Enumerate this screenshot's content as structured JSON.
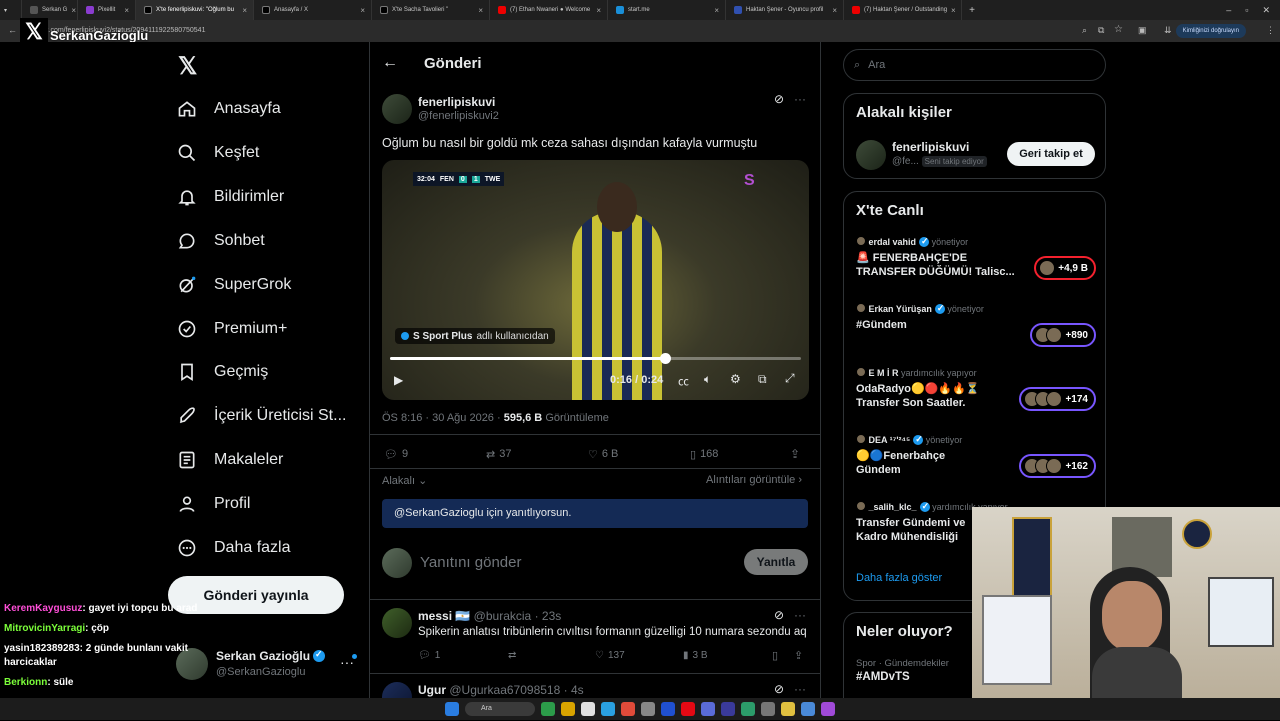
{
  "browser": {
    "tabs": [
      {
        "label": "Serkan G"
      },
      {
        "label": "Pixellit"
      },
      {
        "label": "X'te fenerlipiskuvi: \"Oğlum bu"
      },
      {
        "label": "Anasayfa / X"
      },
      {
        "label": "X'te Sacha Tavolieri \""
      },
      {
        "label": "(7) Ethan Nwaneri ● Welcome"
      },
      {
        "label": "start.me"
      },
      {
        "label": "Haktan Şener - Oyuncu profil"
      },
      {
        "label": "(7) Haktan Şener / Outstanding"
      }
    ],
    "url": "x.com/fenerlipiskuvi2/status/2094111922580750541",
    "verify_label": "Kimliğinizi doğrulayın",
    "stream_overlay_name": "SerkanGazioglu"
  },
  "nav": {
    "items": [
      {
        "label": "Anasayfa",
        "icon": "home-icon"
      },
      {
        "label": "Keşfet",
        "icon": "search-icon"
      },
      {
        "label": "Bildirimler",
        "icon": "bell-icon"
      },
      {
        "label": "Sohbet",
        "icon": "chat-icon"
      },
      {
        "label": "SuperGrok",
        "icon": "grok-icon"
      },
      {
        "label": "Premium+",
        "icon": "verified-icon"
      },
      {
        "label": "Geçmiş",
        "icon": "bookmark-icon"
      },
      {
        "label": "İçerik Üreticisi St...",
        "icon": "rocket-icon"
      },
      {
        "label": "Makaleler",
        "icon": "article-icon"
      },
      {
        "label": "Profil",
        "icon": "person-icon"
      },
      {
        "label": "Daha fazla",
        "icon": "more-circle-icon"
      }
    ],
    "post_button": "Gönderi yayınla",
    "account": {
      "name": "Serkan Gazioğlu",
      "handle": "@SerkanGazioglu"
    }
  },
  "chat_overlay": [
    {
      "user": "KeremKaygusuz",
      "color": "#ff4fd8",
      "text": ": gayet iyi topçu bu arad"
    },
    {
      "user": "MitrovicinYarragi",
      "color": "#7cff3a",
      "text": ": çöp"
    },
    {
      "user": "yasin182389283",
      "color": "#ffffff",
      "text": ": 2 günde bunlanı vakit harcicaklar"
    },
    {
      "user": "Berkionn",
      "color": "#7cff3a",
      "text": ": süle"
    }
  ],
  "main": {
    "header_title": "Gönderi",
    "post": {
      "name": "fenerlipiskuvi",
      "handle": "@fenerlipiskuvi2",
      "text": "Oğlum bu nasıl bir goldü mk ceza sahası dışından kafayla vurmuştu",
      "video": {
        "scoreboard_time": "32:04",
        "home": "FEN",
        "score_home": "0",
        "score_away": "1",
        "away": "TWE",
        "source_channel": "S Sport Plus",
        "source_suffix": "adlı kullanıcıdan",
        "time_current": "0:16",
        "time_total": "0:24",
        "played_fraction": 0.67
      },
      "time": "ÖS 8:16",
      "date": "30 Ağu 2026",
      "views_value": "595,6 B",
      "views_label": "Görüntüleme",
      "replies": "9",
      "reposts": "37",
      "likes": "6 B",
      "bookmarks": "168"
    },
    "sort_label": "Alakalı",
    "quotes_label": "Alıntıları görüntüle",
    "reply_banner": "@SerkanGazioglu için yanıtlıyorsun.",
    "reply_placeholder": "Yanıtını gönder",
    "reply_button": "Yanıtla",
    "replies": [
      {
        "name": "messi",
        "flag": "🇦🇷",
        "handle": "@burakcia",
        "time": "23s",
        "text": "Spikerin anlatısı tribünlerin cıvıltısı formanın güzelligi 10 numara sezondu aq",
        "reply_count": "1",
        "likes": "137",
        "views": "3 B"
      },
      {
        "name": "Ugur",
        "handle": "@Ugurkaa67098518",
        "time": "4s"
      }
    ]
  },
  "right": {
    "search_placeholder": "Ara",
    "related_title": "Alakalı kişiler",
    "related_person": {
      "name": "fenerlipiskuvi",
      "handle": "@fe...",
      "follows_you": "Seni takip ediyor",
      "button": "Geri takip et"
    },
    "live_title": "X'te Canlı",
    "live": [
      {
        "host": "erdal vahid",
        "role": "yönetiyor",
        "title": "🚨 FENERBAHÇE'DE TRANSFER DÜĞÜMÜ! Talisc...",
        "count": "+4,9 B",
        "color": "#f4212e"
      },
      {
        "host": "Erkan Yürüşan",
        "role": "yönetiyor",
        "title": "#Gündem",
        "count": "+890",
        "color": "#7856ff"
      },
      {
        "host": "E M İ R",
        "role": "yardımcılık yapıyor",
        "title": "OdaRadyo🟡🔴🔥🔥⏳ Transfer Son Saatler.",
        "count": "+174",
        "color": "#7856ff"
      },
      {
        "host": "DEA ¹⁷ʹ²⁴⁵",
        "role": "yönetiyor",
        "title": "🟡🔵Fenerbahçe Gündem",
        "count": "+162",
        "color": "#7856ff"
      },
      {
        "host": "_salih_klc_",
        "role": "yardımcılık yapıyor",
        "title": "Transfer Gündemi ve Kadro Mühendisliği",
        "count": "",
        "color": "#7856ff"
      }
    ],
    "show_more": "Daha fazla göster",
    "trends_title": "Neler oluyor?",
    "trend": {
      "context": "Spor · Gündemdekiler",
      "tag": "#AMDvTS"
    }
  },
  "colors": {
    "accent": "#1d9bf0",
    "bg": "#000000",
    "border": "#2f3336",
    "muted": "#71767b"
  }
}
